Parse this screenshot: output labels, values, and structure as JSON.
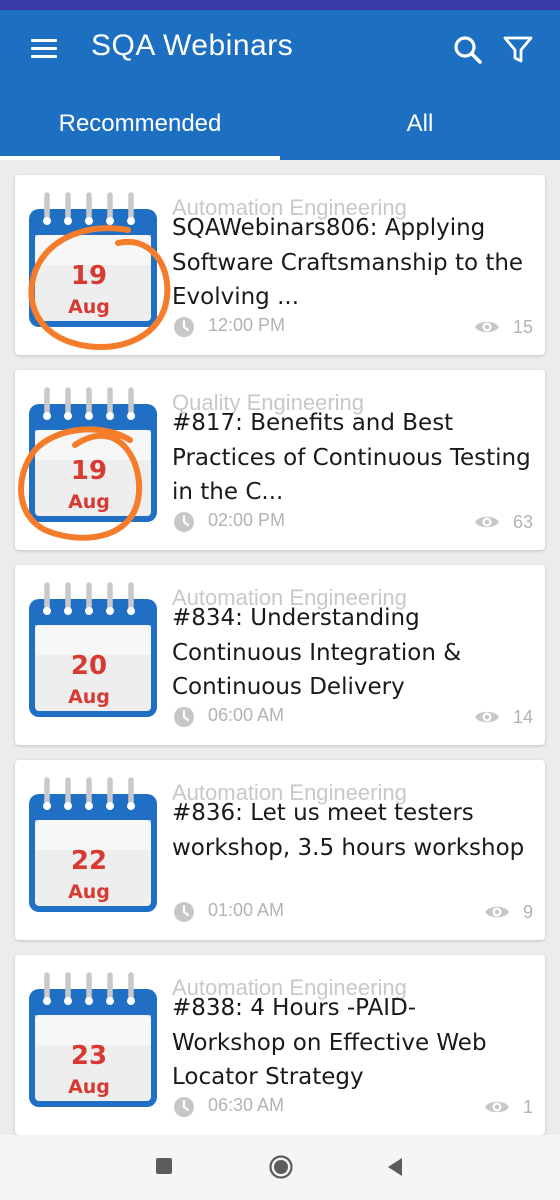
{
  "app": {
    "title": "SQA Webinars"
  },
  "header": {
    "menu_icon": "menu-icon",
    "search_icon": "search-icon",
    "filter_icon": "filter-icon"
  },
  "tabs": [
    {
      "label": "Recommended",
      "selected": true
    },
    {
      "label": "All",
      "selected": false
    }
  ],
  "webinars": [
    {
      "category": "Automation Engineering",
      "title": "SQAWebinars806: Applying Software Craftsmanship to the Evolving ...",
      "day": "19",
      "month": "Aug",
      "time": "12:00 PM",
      "views": "15"
    },
    {
      "category": "Quality Engineering",
      "title": "#817: Benefits and Best Practices of Continuous Testing in the C...",
      "day": "19",
      "month": "Aug",
      "time": "02:00 PM",
      "views": "63"
    },
    {
      "category": "Automation Engineering",
      "title": "#834: Understanding Continuous Integration & Continuous Delivery",
      "day": "20",
      "month": "Aug",
      "time": "06:00 AM",
      "views": "14"
    },
    {
      "category": "Automation Engineering",
      "title": "#836: Let us meet testers workshop, 3.5 hours workshop",
      "day": "22",
      "month": "Aug",
      "time": "01:00 AM",
      "views": "9"
    },
    {
      "category": "Automation Engineering",
      "title": "#838: 4 Hours -PAID- Workshop on Effective Web Locator Strategy",
      "day": "23",
      "month": "Aug",
      "time": "06:30 AM",
      "views": "1"
    }
  ],
  "colors": {
    "app_bar": "#1d6fc2",
    "status_bar": "#3a3aa6",
    "calendar_blue": "#1f6fc4",
    "date_red": "#d63a32",
    "annotation": "#f57c2a"
  },
  "navbar": {
    "icons": [
      "recents-square-icon",
      "home-circle-icon",
      "back-triangle-icon"
    ]
  }
}
